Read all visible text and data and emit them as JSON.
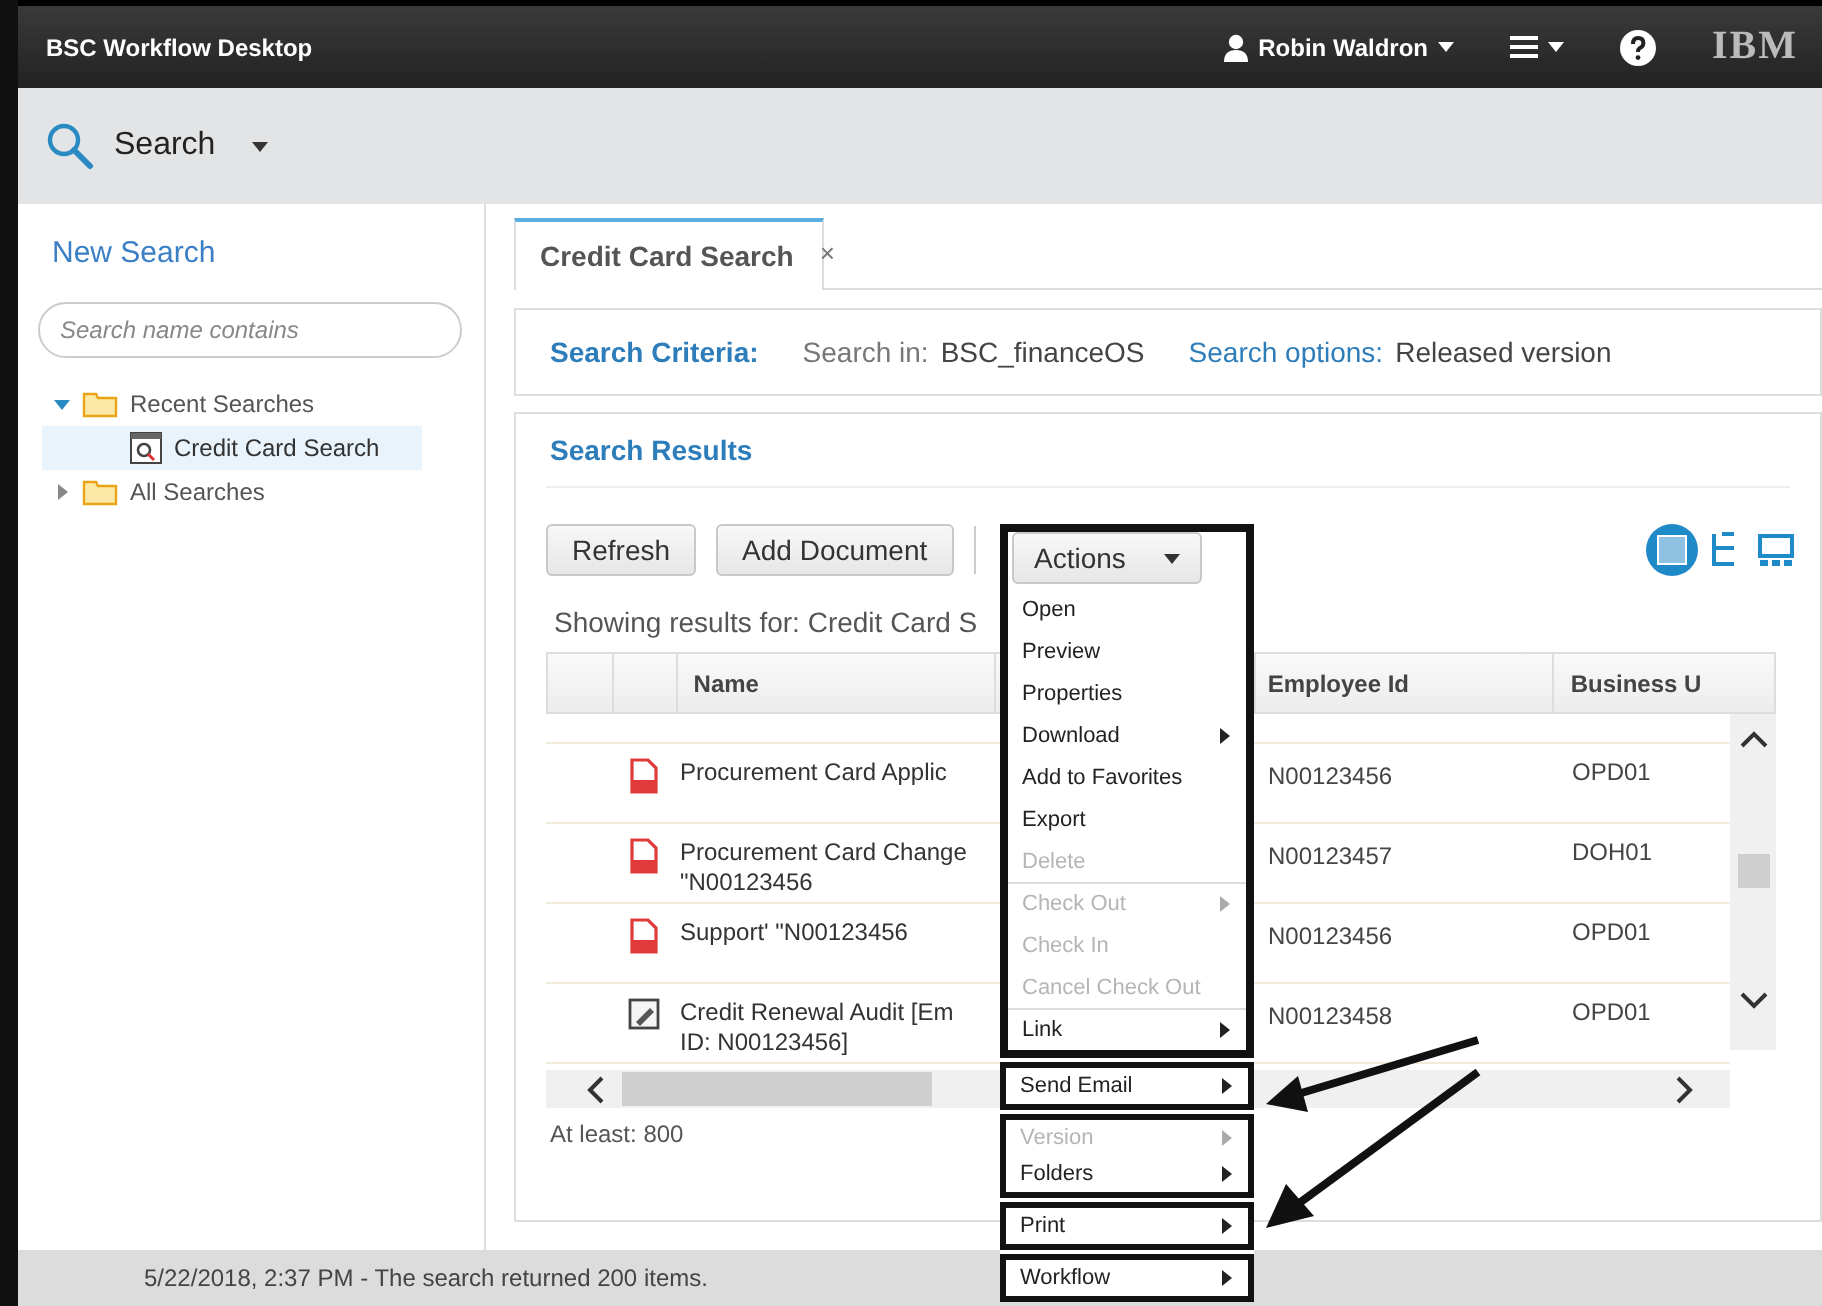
{
  "header": {
    "title": "BSC Workflow Desktop",
    "user": "Robin Waldron",
    "logo": "IBM"
  },
  "toolbar": {
    "label": "Search"
  },
  "sidebar": {
    "new_search": "New Search",
    "filter": {
      "placeholder": "Search name contains"
    },
    "tree": [
      {
        "kind": "folder",
        "label": "Recent Searches",
        "expanded": true,
        "children": [
          {
            "kind": "search",
            "label": "Credit Card Search",
            "selected": true
          }
        ]
      },
      {
        "kind": "folder",
        "label": "All Searches",
        "expanded": false
      }
    ]
  },
  "tabs": [
    {
      "label": "Credit Card Search",
      "selected": true,
      "close": "×"
    }
  ],
  "criteria": {
    "title": "Search Criteria:",
    "search_in_label": "Search in:",
    "search_in_value": "BSC_financeOS",
    "options_label": "Search options:",
    "options_value": "Released version"
  },
  "results": {
    "title": "Search Results",
    "buttons": [
      "Refresh",
      "Add Document"
    ],
    "views": [
      {
        "kind": "details",
        "selected": true
      },
      {
        "kind": "tree",
        "selected": false
      },
      {
        "kind": "thumbs",
        "selected": false
      }
    ],
    "showing": "Showing results for: Credit Card S",
    "columns": [
      "Name",
      "Employee Id",
      "Business U"
    ],
    "rows": [
      {
        "kind": "pdf",
        "name": [
          "Procurement Card Applic"
        ],
        "employee_id": "N00123456",
        "business_unit": "OPD01"
      },
      {
        "kind": "pdf",
        "name": [
          "Procurement Card Change",
          "\"N00123456"
        ],
        "employee_id": "N00123457",
        "business_unit": "DOH01"
      },
      {
        "kind": "pdf",
        "name": [
          "Support' \"N00123456"
        ],
        "employee_id": "N00123456",
        "business_unit": "OPD01"
      },
      {
        "kind": "doc",
        "name": [
          "Credit Renewal Audit [Em",
          "ID: N00123456]"
        ],
        "employee_id": "N00123458",
        "business_unit": "OPD01"
      }
    ],
    "count": "At least: 800"
  },
  "menu": {
    "button": "Actions",
    "boxes": [
      {
        "items": [
          {
            "label": "Open",
            "disabled": false,
            "submenu": false,
            "divider_above": false
          },
          {
            "label": "Preview",
            "disabled": false,
            "submenu": false,
            "divider_above": false
          },
          {
            "label": "Properties",
            "disabled": false,
            "submenu": false,
            "divider_above": false
          },
          {
            "label": "Download",
            "disabled": false,
            "submenu": true,
            "divider_above": false
          },
          {
            "label": "Add to Favorites",
            "disabled": false,
            "submenu": false,
            "divider_above": false
          },
          {
            "label": "Export",
            "disabled": false,
            "submenu": false,
            "divider_above": false
          },
          {
            "label": "Delete",
            "disabled": true,
            "submenu": false,
            "divider_above": false
          },
          {
            "label": "Check Out",
            "disabled": true,
            "submenu": true,
            "divider_above": true
          },
          {
            "label": "Check In",
            "disabled": true,
            "submenu": false,
            "divider_above": false
          },
          {
            "label": "Cancel Check Out",
            "disabled": true,
            "submenu": false,
            "divider_above": false
          },
          {
            "label": "Link",
            "disabled": false,
            "submenu": true,
            "divider_above": true
          }
        ]
      },
      {
        "items": [
          {
            "label": "Send Email",
            "disabled": false,
            "submenu": true,
            "divider_above": false
          }
        ]
      },
      {
        "items": [
          {
            "label": "Version",
            "disabled": true,
            "submenu": true,
            "divider_above": false
          },
          {
            "label": "Folders",
            "disabled": false,
            "submenu": true,
            "divider_above": false
          }
        ]
      },
      {
        "items": [
          {
            "label": "Print",
            "disabled": false,
            "submenu": true,
            "divider_above": false
          }
        ]
      },
      {
        "items": [
          {
            "label": "Workflow",
            "disabled": false,
            "submenu": true,
            "divider_above": false
          }
        ]
      }
    ]
  },
  "status_bar": "5/22/2018, 2:37 PM - The search returned 200 items."
}
